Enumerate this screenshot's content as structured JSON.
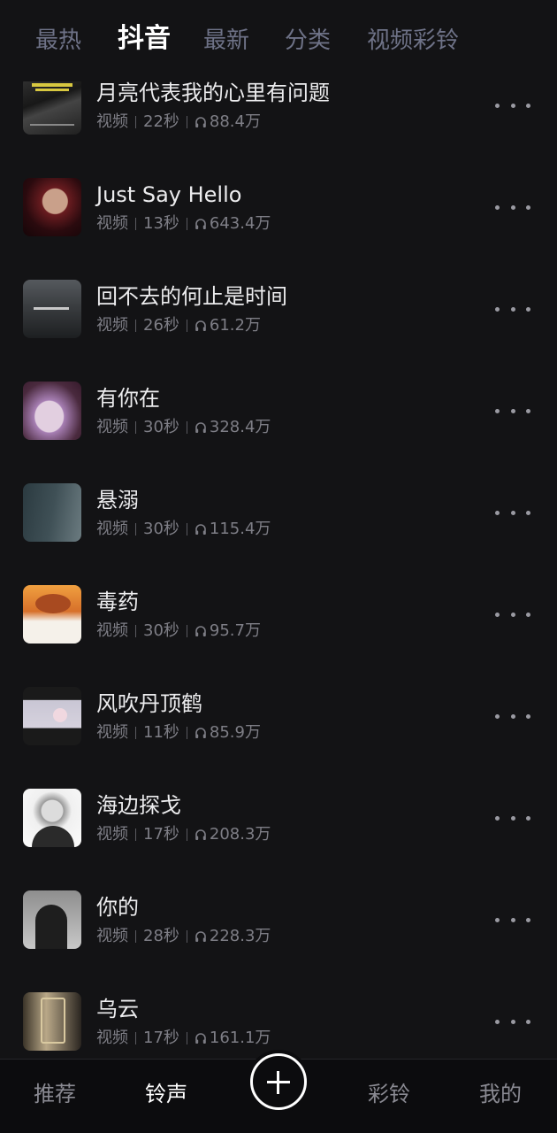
{
  "top_tabs": [
    {
      "label": "最热",
      "active": false
    },
    {
      "label": "抖音",
      "active": true
    },
    {
      "label": "最新",
      "active": false
    },
    {
      "label": "分类",
      "active": false
    },
    {
      "label": "视频彩铃",
      "active": false
    }
  ],
  "items": [
    {
      "title": "月亮代表我的心里有问题",
      "type": "视频",
      "duration": "22秒",
      "plays": "88.4万"
    },
    {
      "title": "Just Say Hello",
      "type": "视频",
      "duration": "13秒",
      "plays": "643.4万"
    },
    {
      "title": "回不去的何止是时间",
      "type": "视频",
      "duration": "26秒",
      "plays": "61.2万"
    },
    {
      "title": "有你在",
      "type": "视频",
      "duration": "30秒",
      "plays": "328.4万"
    },
    {
      "title": "悬溺",
      "type": "视频",
      "duration": "30秒",
      "plays": "115.4万"
    },
    {
      "title": "毒药",
      "type": "视频",
      "duration": "30秒",
      "plays": "95.7万"
    },
    {
      "title": "风吹丹顶鹤",
      "type": "视频",
      "duration": "11秒",
      "plays": "85.9万"
    },
    {
      "title": "海边探戈",
      "type": "视频",
      "duration": "17秒",
      "plays": "208.3万"
    },
    {
      "title": "你的",
      "type": "视频",
      "duration": "28秒",
      "plays": "228.3万"
    },
    {
      "title": "乌云",
      "type": "视频",
      "duration": "17秒",
      "plays": "161.1万"
    }
  ],
  "bottom_nav": [
    {
      "label": "推荐",
      "active": false
    },
    {
      "label": "铃声",
      "active": true
    },
    {
      "label": "彩铃",
      "active": false
    },
    {
      "label": "我的",
      "active": false
    }
  ],
  "icons": {
    "play_count": "headphones-icon",
    "more": "more-dots-icon",
    "add": "add-circle-icon"
  },
  "colors": {
    "background": "#131315",
    "active_tab": "#ffffff",
    "inactive_tab": "#6e7287",
    "meta_text": "#7e7e86"
  }
}
